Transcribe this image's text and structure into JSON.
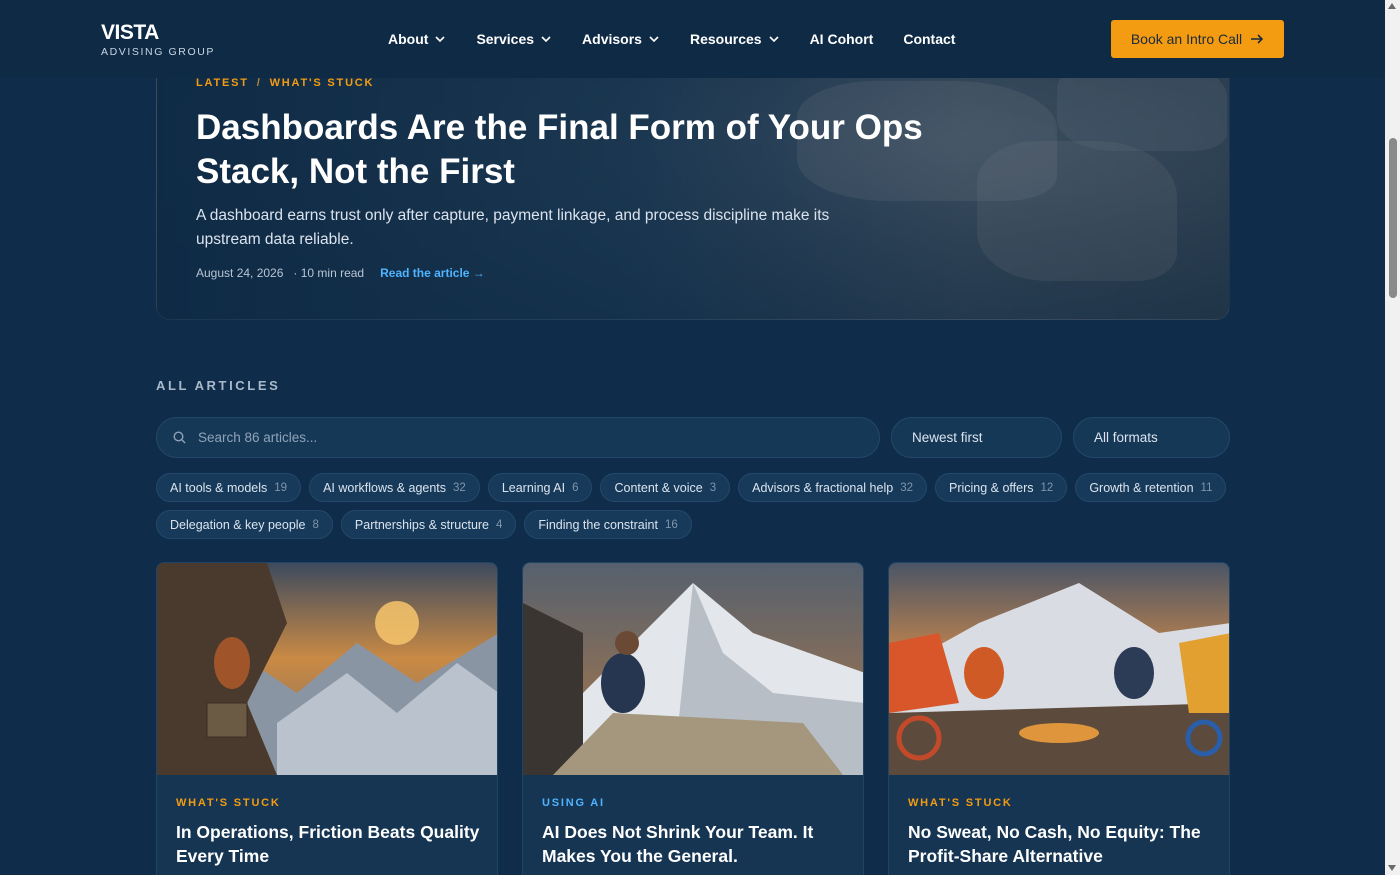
{
  "brand": {
    "name": "VISTA",
    "tagline": "ADVISING GROUP"
  },
  "nav": {
    "items": [
      {
        "label": "About",
        "dropdown": true
      },
      {
        "label": "Services",
        "dropdown": true
      },
      {
        "label": "Advisors",
        "dropdown": true
      },
      {
        "label": "Resources",
        "dropdown": true
      },
      {
        "label": "AI Cohort",
        "dropdown": false
      },
      {
        "label": "Contact",
        "dropdown": false
      }
    ],
    "cta_label": "Book an Intro Call"
  },
  "hero": {
    "crumb_latest": "LATEST",
    "crumb_sep": "/",
    "crumb_category": "WHAT'S STUCK",
    "title": "Dashboards Are the Final Form of Your Ops Stack, Not the First",
    "description": "A dashboard earns trust only after capture, payment linkage, and process discipline make its upstream data reliable.",
    "date": "August 24, 2026",
    "read_time": "· 10 min read",
    "read_link": "Read the article →"
  },
  "articles": {
    "section_label": "ALL ARTICLES",
    "search_placeholder": "Search 86 articles...",
    "sort_value": "Newest first",
    "format_value": "All formats",
    "topics_row1": [
      {
        "label": "AI tools & models",
        "count": "19"
      },
      {
        "label": "AI workflows & agents",
        "count": "32"
      },
      {
        "label": "Learning AI",
        "count": "6"
      },
      {
        "label": "Content & voice",
        "count": "3"
      },
      {
        "label": "Advisors & fractional help",
        "count": "32"
      },
      {
        "label": "Pricing & offers",
        "count": "12"
      },
      {
        "label": "Growth & retention",
        "count": "11"
      }
    ],
    "topics_row2": [
      {
        "label": "Delegation & key people",
        "count": "8"
      },
      {
        "label": "Partnerships & structure",
        "count": "4"
      },
      {
        "label": "Finding the constraint",
        "count": "16"
      }
    ],
    "cards": [
      {
        "category": "WHAT'S STUCK",
        "title": "In Operations, Friction Beats Quality Every Time",
        "category_color": "#f39c12"
      },
      {
        "category": "USING AI",
        "title": "AI Does Not Shrink Your Team. It Makes You the General.",
        "category_color": "#4fb3ff"
      },
      {
        "category": "WHAT'S STUCK",
        "title": "No Sweat, No Cash, No Equity: The Profit-Share Alternative",
        "category_color": "#f39c12"
      }
    ]
  },
  "colors": {
    "accent": "#f39c12",
    "link": "#4fb3ff",
    "background": "#0f2d4a"
  }
}
